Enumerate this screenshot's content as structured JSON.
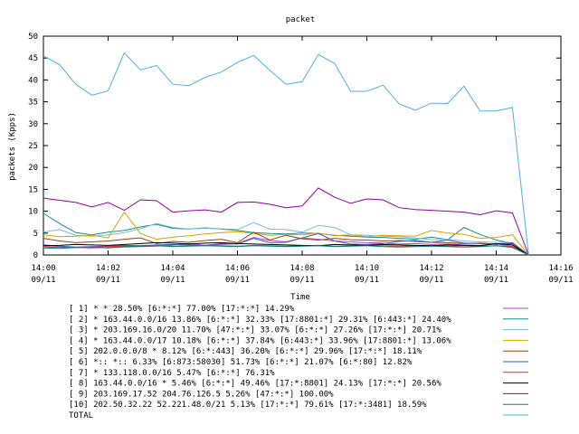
{
  "chart_data": {
    "type": "line",
    "title": "packet",
    "xlabel": "Time",
    "ylabel": "packets (Kpps)",
    "ylim": [
      0,
      50
    ],
    "yticks": [
      0,
      5,
      10,
      15,
      20,
      25,
      30,
      35,
      40,
      45,
      50
    ],
    "xlim": [
      0,
      16
    ],
    "xticks": [
      {
        "t": 0,
        "time": "14:00",
        "date": "09/11"
      },
      {
        "t": 2,
        "time": "14:02",
        "date": "09/11"
      },
      {
        "t": 4,
        "time": "14:04",
        "date": "09/11"
      },
      {
        "t": 6,
        "time": "14:06",
        "date": "09/11"
      },
      {
        "t": 8,
        "time": "14:08",
        "date": "09/11"
      },
      {
        "t": 10,
        "time": "14:10",
        "date": "09/11"
      },
      {
        "t": 12,
        "time": "14:12",
        "date": "09/11"
      },
      {
        "t": 14,
        "time": "14:14",
        "date": "09/11"
      },
      {
        "t": 16,
        "time": "14:16",
        "date": "09/11"
      }
    ],
    "grid": false,
    "legend_position": "bottom",
    "x": [
      0,
      0.5,
      1,
      1.5,
      2,
      2.5,
      3,
      3.5,
      4,
      4.5,
      5,
      5.5,
      6,
      6.5,
      7,
      7.5,
      8,
      8.5,
      9,
      9.5,
      10,
      10.5,
      11,
      11.5,
      12,
      12.5,
      13,
      13.5,
      14,
      14.5,
      15
    ],
    "series": [
      {
        "name": "[ 1] * * 28.50%  [6:*:*] 77.00% [17:*:*] 14.29%",
        "color": "#c040c0",
        "values": [
          1.6,
          1.8,
          1.7,
          1.6,
          1.7,
          1.8,
          1.9,
          2.0,
          2.3,
          2.6,
          2.2,
          2.4,
          2.6,
          4.0,
          3.3,
          3.0,
          3.9,
          3.6,
          3.2,
          3.0,
          2.8,
          2.7,
          2.5,
          2.6,
          2.4,
          2.5,
          2.3,
          2.2,
          2.5,
          2.0,
          0
        ]
      },
      {
        "name": "[ 2] * 163.44.0.0/16 13.86%  [6:*:*] 32.33% [17:8801:*] 29.31% [6:443:*] 24.40%",
        "color": "#109090",
        "values": [
          9.5,
          7.2,
          5.1,
          4.6,
          5.2,
          5.6,
          6.4,
          7.0,
          6.1,
          5.9,
          6.2,
          5.9,
          5.6,
          5.1,
          4.9,
          4.8,
          5.0,
          4.9,
          4.5,
          4.3,
          4.1,
          4.0,
          3.8,
          3.6,
          4.1,
          3.5,
          6.3,
          4.7,
          3.4,
          2.6,
          0
        ]
      },
      {
        "name": "[ 3] * 203.169.16.0/20 11.70%  [47:*:*] 33.07% [6:*:*] 27.26% [17:*:*] 20.71%",
        "color": "#80b8e0",
        "values": [
          5.2,
          5.8,
          4.5,
          4.3,
          4.6,
          5.1,
          6.0,
          7.2,
          6.3,
          5.9,
          6.1,
          6.0,
          5.8,
          7.4,
          5.9,
          5.8,
          5.2,
          6.8,
          6.3,
          4.6,
          4.5,
          4.3,
          4.2,
          3.9,
          3.5,
          3.6,
          3.2,
          3.0,
          2.9,
          2.8,
          0
        ]
      },
      {
        "name": "[ 4] * 163.44.0.0/17 10.18%  [6:*:*] 37.84% [6:443:*] 33.96% [17:8801:*] 13.06%",
        "color": "#e0a000",
        "values": [
          4.6,
          4.2,
          4.3,
          4.5,
          3.9,
          9.8,
          4.9,
          3.6,
          4.1,
          4.4,
          4.8,
          5.1,
          5.3,
          4.9,
          4.5,
          4.7,
          4.6,
          5.0,
          4.4,
          4.6,
          4.2,
          4.5,
          4.4,
          4.3,
          5.6,
          5.0,
          4.7,
          3.8,
          4.0,
          4.6,
          0
        ]
      },
      {
        "name": "[ 5] 202.0.0.0/8 * 8.12%  [6:*:443] 36.20% [6:*:*] 29.96% [17:*:*] 18.11%",
        "color": "#a04010",
        "values": [
          3.8,
          3.2,
          2.8,
          3.0,
          3.2,
          3.6,
          3.9,
          2.6,
          3.1,
          2.9,
          3.3,
          3.6,
          2.8,
          5.2,
          3.4,
          4.5,
          3.7,
          3.4,
          3.8,
          3.5,
          3.4,
          3.2,
          3.3,
          3.1,
          2.9,
          2.8,
          2.6,
          2.7,
          2.5,
          2.6,
          0
        ]
      },
      {
        "name": "[ 6] *:: *:: 6.33%  [6:873:58030] 51.73% [6:*:*] 21.07% [6:*:80] 12.82%",
        "color": "#3060c0",
        "values": [
          2.3,
          2.0,
          1.8,
          1.9,
          2.0,
          2.2,
          2.1,
          2.3,
          2.4,
          2.3,
          2.2,
          2.6,
          2.5,
          3.8,
          2.8,
          2.9,
          3.9,
          4.9,
          3.2,
          2.5,
          2.4,
          2.6,
          3.1,
          3.3,
          2.9,
          3.4,
          2.7,
          2.6,
          2.4,
          2.8,
          0
        ]
      },
      {
        "name": "[ 7] * 133.118.0.0/16 5.47%  [6:*:*] 76.31%",
        "color": "#e03030",
        "values": [
          1.9,
          1.8,
          1.7,
          1.8,
          1.9,
          2.0,
          2.1,
          2.2,
          2.0,
          2.1,
          2.2,
          2.1,
          2.0,
          2.2,
          2.1,
          2.0,
          2.1,
          2.2,
          2.0,
          2.1,
          2.2,
          2.1,
          2.0,
          2.1,
          2.2,
          2.0,
          2.1,
          2.0,
          2.1,
          1.9,
          0
        ]
      },
      {
        "name": "[ 8] 163.44.0.0/16 * 5.46%  [6:*:*] 49.46% [17:*:8801] 24.13% [17:*:*] 20.56%",
        "color": "#000000",
        "values": [
          2.1,
          2.2,
          2.4,
          2.3,
          2.2,
          2.4,
          2.6,
          2.8,
          2.7,
          2.5,
          2.7,
          2.8,
          2.6,
          2.5,
          2.4,
          2.3,
          2.2,
          2.1,
          2.4,
          2.3,
          2.2,
          2.4,
          2.3,
          2.2,
          2.1,
          2.3,
          2.2,
          2.1,
          2.6,
          2.3,
          0
        ]
      },
      {
        "name": "[ 9] 203.169.17.52 204.76.126.5 5.26%  [47:*:*] 100.00%",
        "color": "#9000a0",
        "values": [
          13.0,
          12.5,
          12.0,
          11.0,
          12.0,
          10.2,
          12.6,
          12.4,
          9.8,
          10.1,
          10.3,
          9.8,
          12.0,
          12.1,
          11.6,
          10.8,
          11.2,
          15.3,
          13.2,
          11.8,
          12.8,
          12.6,
          10.8,
          10.4,
          10.2,
          10.0,
          9.8,
          9.2,
          10.1,
          9.6,
          0
        ]
      },
      {
        "name": "[10] 202.50.32.22 52.221.48.0/21 5.13%  [17:*:*] 79.61% [17:*:3481] 18.59%",
        "color": "#108070",
        "values": [
          1.6,
          1.5,
          1.7,
          1.8,
          1.6,
          1.9,
          2.0,
          2.1,
          1.9,
          2.0,
          2.1,
          2.0,
          1.9,
          2.1,
          2.0,
          1.9,
          2.0,
          2.1,
          1.9,
          2.0,
          2.1,
          1.9,
          1.8,
          1.9,
          2.0,
          1.9,
          1.8,
          1.9,
          2.1,
          1.7,
          0
        ]
      },
      {
        "name": "TOTAL",
        "color": "#50b0e0",
        "values": [
          45.5,
          43.5,
          39.0,
          36.5,
          37.5,
          46.2,
          42.3,
          43.3,
          39.0,
          38.7,
          40.6,
          41.8,
          44.0,
          45.6,
          42.2,
          39.0,
          39.6,
          45.8,
          43.8,
          37.4,
          37.4,
          38.8,
          34.5,
          33.1,
          34.7,
          34.6,
          38.6,
          32.9,
          32.9,
          33.7,
          0
        ]
      }
    ]
  }
}
